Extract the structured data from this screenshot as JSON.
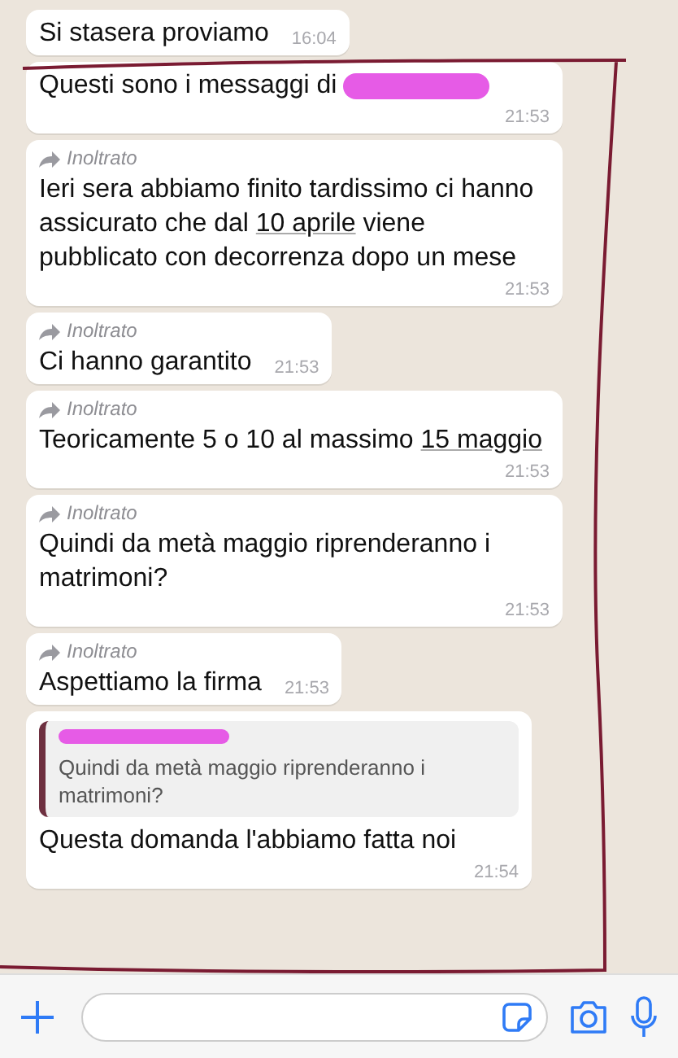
{
  "messages": [
    {
      "forwarded": false,
      "text": [
        {
          "text": "Si stasera proviamo"
        }
      ],
      "time": "16:04"
    },
    {
      "forwarded": false,
      "text": [
        {
          "text": "Questi sono i messaggi di"
        }
      ],
      "redacted": true,
      "time": "21:53"
    },
    {
      "forwarded": true,
      "forward_label": "Inoltrato",
      "text": [
        {
          "text": "Ieri sera abbiamo finito tardissimo ci hanno assicurato che dal "
        },
        {
          "text": "10 aprile",
          "kind": "link"
        },
        {
          "text": " viene pubblicato con decorrenza dopo un mese"
        }
      ],
      "time": "21:53"
    },
    {
      "forwarded": true,
      "forward_label": "Inoltrato",
      "text": [
        {
          "text": "Ci hanno garantito"
        }
      ],
      "time": "21:53"
    },
    {
      "forwarded": true,
      "forward_label": "Inoltrato",
      "text": [
        {
          "text": "Teoricamente 5 o 10 al massimo "
        },
        {
          "text": "15 maggio",
          "kind": "link"
        }
      ],
      "time": "21:53"
    },
    {
      "forwarded": true,
      "forward_label": "Inoltrato",
      "text": [
        {
          "text": "Quindi da metà maggio riprenderanno i matrimoni?"
        }
      ],
      "time": "21:53"
    },
    {
      "forwarded": true,
      "forward_label": "Inoltrato",
      "text": [
        {
          "text": "Aspettiamo la firma"
        }
      ],
      "time": "21:53"
    },
    {
      "forwarded": false,
      "quote": {
        "author_redacted": true,
        "text": "Quindi da metà maggio riprenderanno i matrimoni?"
      },
      "text": [
        {
          "text": "Questa domanda l'abbiamo fatta noi"
        }
      ],
      "time": "21:54"
    }
  ]
}
